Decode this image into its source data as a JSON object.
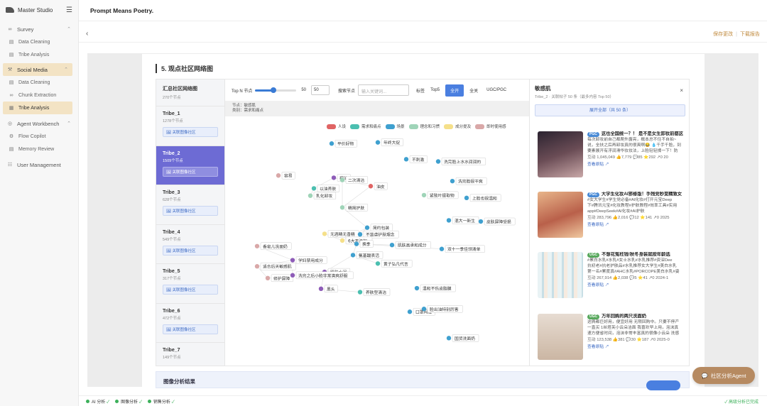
{
  "app": {
    "name": "Master Studio",
    "title": "Prompt Means Poetry."
  },
  "sidebar": {
    "sections": [
      {
        "label": "Survey",
        "items": [
          "Data Cleaning",
          "Tribe Analysis"
        ]
      },
      {
        "label": "Social Media",
        "items": [
          "Data Cleaning",
          "Chunk Extraction",
          "Tribe Analysis"
        ]
      },
      {
        "label": "Agent Workbench",
        "items": [
          "Flow Copilot",
          "Memory Review"
        ]
      }
    ],
    "user_management": "User Management"
  },
  "header": {
    "save": "保存更改",
    "download": "下载报告",
    "sep": "|"
  },
  "section": {
    "title": "5. 观点社区网络图"
  },
  "tribe_list": {
    "title": "汇总社区网络图",
    "subtitle": "270个节点",
    "tribes": [
      {
        "name": "Tribe_1",
        "count": "1278个节点",
        "badge": "关联图像社区"
      },
      {
        "name": "Tribe_2",
        "count": "1509个节点",
        "badge": "关联图像社区"
      },
      {
        "name": "Tribe_3",
        "count": "628个节点",
        "badge": "关联图像社区"
      },
      {
        "name": "Tribe_4",
        "count": "549个节点",
        "badge": "关联图像社区"
      },
      {
        "name": "Tribe_5",
        "count": "317个节点",
        "badge": "关联图像社区"
      },
      {
        "name": "Tribe_6",
        "count": "472个节点",
        "badge": "关联图像社区"
      },
      {
        "name": "Tribe_7",
        "count": "149个节点",
        "badge": ""
      }
    ]
  },
  "toolbar": {
    "topn_label": "Top N 节点",
    "topn_value": "50",
    "topn_input": "50",
    "search_label": "搜索节点",
    "search_placeholder": "输入关键词...",
    "tag_label": "标签",
    "top5": "Top5",
    "all_on": "全开",
    "all_off": "全关",
    "ugc_pgc": "UGC/PGC"
  },
  "node_info": {
    "node": "节点：敏感肌",
    "category": "类别：需求和痛点"
  },
  "legend": [
    {
      "label": "人设",
      "color": "#e06464"
    },
    {
      "label": "需求和痛点",
      "color": "#4bbfb0"
    },
    {
      "label": "场景",
      "color": "#3fa0cf"
    },
    {
      "label": "理念和习惯",
      "color": "#9fd4b8"
    },
    {
      "label": "成分提及",
      "color": "#f5e08a"
    },
    {
      "label": "即时使用感",
      "color": "#d9a8a8"
    }
  ],
  "graph_labels": [
    "平价好物",
    "年终大促",
    "不刺激",
    "洗完脸上水水润润的",
    "容易",
    "控油",
    "二次清洁",
    "油皮",
    "以油养肤",
    "乳化卸妆",
    "洗完脸很干爽",
    "紧致叶提取物",
    "上脸也很温和",
    "精简护肤",
    "混大一新生",
    "皮肤屏障受损",
    "简约包装",
    "无酒精无香精",
    "不滥虐护肤理念",
    "6大不添加",
    "换季",
    "肌肤高承和成分",
    "双十一季佳领清单",
    "香皂儿洗面奶",
    "氨基酸表活",
    "黄子弘凡代言",
    "学妇禁用成分",
    "适合后天敏感肌",
    "肌肤水润",
    "修护屏障",
    "温和不伤皮脂膜",
    "洗完之后小脸非常清爽舒服",
    "黑头",
    "养肤型清洁",
    "口罩闷痘",
    "脸出油特别厉害",
    "国货洗面奶"
  ],
  "drawer": {
    "title": "敏感肌",
    "subtitle": "Tribe_2 · 关联帖子 50 条（最多内容 Top 50）",
    "close": "×",
    "expand": "展开全部（共 50 条）",
    "posts": [
      {
        "tag": "PGC",
        "title": "这也全国统一？！ 是不是女生卸妆前都这",
        "text": "每次卸妆前自己都爬外露亮，概本总不住不自拍~",
        "text2": "说，全扶之后再卸妆真的很爽啊😂 💧千手千脸，到",
        "text3": "要素展开有浮润滑华妆妆法，上脸轻轻揉一下！防",
        "meta": "互动 1,045,049  👍7,779  💬85  ⭐292  ↗0  20",
        "link": "查看原贴 ↗"
      },
      {
        "tag": "PGC",
        "title": "大学生化妆AI邪修版！手残党秒变精致女",
        "text": "#女大学生#学生党必备#AI化妆#打开元宝Deep",
        "text2": "下#腾讯元宝#化妆教程#护肤教程#效率工具#实用",
        "text3": "app#DeepSeek#AI化妆#AI护肤",
        "meta": "互动 283,796  👍2,016  💬12  ⭐141  ↗0  2025",
        "link": "查看原贴 ↗"
      },
      {
        "tag": "UGC",
        "title": "不想花冤枉钱!秋冬身装就按年龄选",
        "text": "#累白水乳#水乳#女士水乳#水乳推荐#资深Dee",
        "text2": "抗初老#抗老护肤品#水乳推荐女大学生#美白水乳",
        "text3": "第一名#累度真#AHC水乳#PORCOPE美白水乳#姿",
        "meta": "互动 267,914  👍2,038  💬5  ⭐41  ↗0  2024-1",
        "link": "查看原贴 ↗"
      },
      {
        "tag": "UGC",
        "title": "万年回购的两只洗面奶",
        "text": "这俩都巨好用，便宜好用 无限回购中。只要不停产",
        "text2": "一直买 1丝塔芙小云朵洁面 我喜欢早上用，泡沫真",
        "text3": "速方便省时间，泡沫非常丰富真的很像小云朵 洗感",
        "meta": "互动 123,538  👍381  💬30  ⭐187  ↗0  2025-0",
        "link": "查看原贴 ↗"
      }
    ]
  },
  "results": {
    "title": "图像分析结果"
  },
  "fab": {
    "label": "社区分析Agent"
  },
  "statusbar": {
    "items": [
      "AI 分析",
      "图像分析",
      "销售分析"
    ],
    "check": "✓",
    "right": "✓ 高级分析已完成"
  }
}
